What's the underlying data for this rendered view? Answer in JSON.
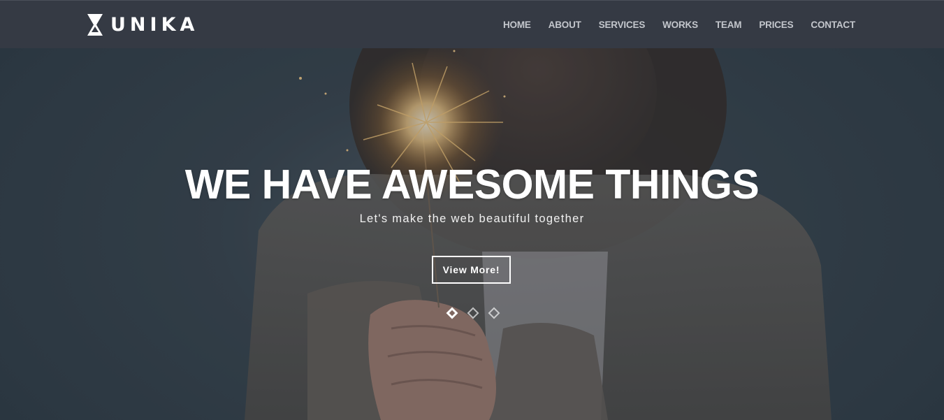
{
  "brand": {
    "name": "UNIKA",
    "logo_icon": "hourglass-icon"
  },
  "nav": {
    "items": [
      {
        "label": "HOME"
      },
      {
        "label": "ABOUT"
      },
      {
        "label": "SERVICES"
      },
      {
        "label": "WORKS"
      },
      {
        "label": "TEAM"
      },
      {
        "label": "PRICES"
      },
      {
        "label": "CONTACT"
      }
    ]
  },
  "hero": {
    "headline": "WE HAVE AWESOME THINGS",
    "subheadline": "Let's make the web beautiful together",
    "cta_label": "View More!",
    "slider": {
      "slide_count": 3,
      "active_index": 0
    }
  },
  "colors": {
    "navbar_bg": "#353a44",
    "nav_text": "#c3c6cc",
    "hero_text": "#ffffff"
  }
}
